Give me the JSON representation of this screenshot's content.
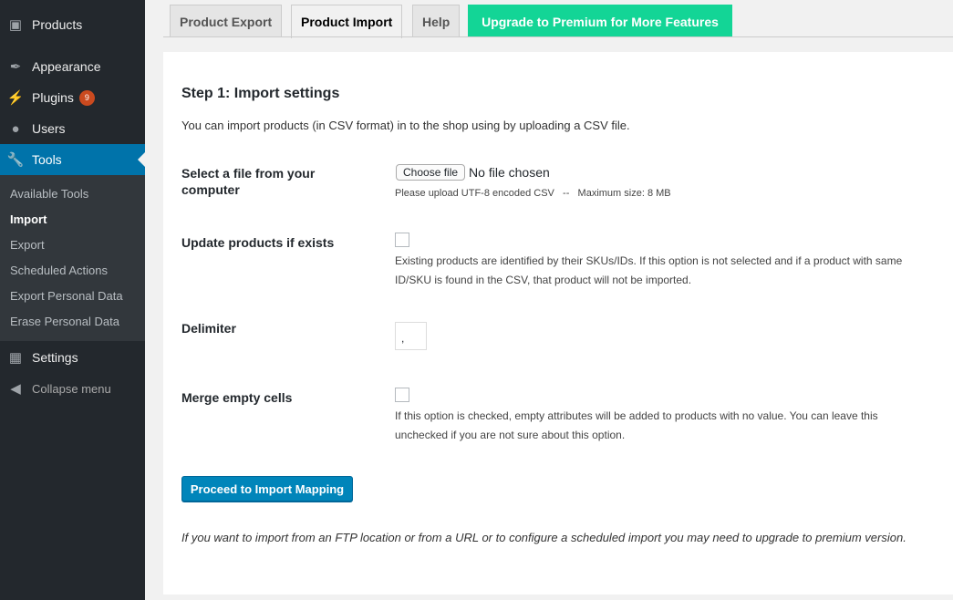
{
  "sidebar": {
    "items": [
      {
        "label": "Products",
        "icon": "box-icon"
      },
      {
        "label": "Appearance",
        "icon": "paintbrush-icon"
      },
      {
        "label": "Plugins",
        "icon": "plugin-icon",
        "badge": "9"
      },
      {
        "label": "Users",
        "icon": "user-icon"
      },
      {
        "label": "Tools",
        "icon": "wrench-icon"
      },
      {
        "label": "Settings",
        "icon": "settings-icon"
      },
      {
        "label": "Collapse menu",
        "icon": "collapse-icon"
      }
    ],
    "submenu": [
      "Available Tools",
      "Import",
      "Export",
      "Scheduled Actions",
      "Export Personal Data",
      "Erase Personal Data"
    ],
    "active_color": "#0073aa"
  },
  "tabs": [
    "Product Export",
    "Product Import",
    "Help",
    "Upgrade to Premium for More Features"
  ],
  "premium_color": "#13d596",
  "main": {
    "heading": "Step 1: Import settings",
    "intro": "You can import products (in CSV format) in to the shop using by uploading a CSV file.",
    "file": {
      "label": "Select a file from your computer",
      "button": "Choose file",
      "status": "No file chosen",
      "note": "Please upload UTF-8 encoded CSV   --   Maximum size: 8 MB"
    },
    "update": {
      "label": "Update products if exists",
      "checked": false,
      "desc": "Existing products are identified by their SKUs/IDs. If this option is not selected and if a product with same ID/SKU is found in the CSV, that product will not be imported."
    },
    "delimiter": {
      "label": "Delimiter",
      "value": ","
    },
    "merge": {
      "label": "Merge empty cells",
      "checked": false,
      "desc": "If this option is checked, empty attributes will be added to products with no value. You can leave this unchecked if you are not sure about this option."
    },
    "submit": "Proceed to Import Mapping",
    "footer": "If you want to import from an FTP location or from a URL or to configure a scheduled import you may need to upgrade to premium version."
  }
}
